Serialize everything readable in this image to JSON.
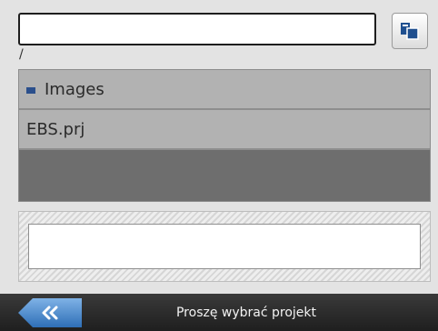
{
  "path_field": {
    "value": "",
    "placeholder": ""
  },
  "copy_button": {
    "icon": "paste-icon",
    "color": "#1f4f8f"
  },
  "current_path": "/",
  "file_list": {
    "items": [
      {
        "label": "Images",
        "type": "folder",
        "icon": "folder-icon"
      },
      {
        "label": "EBS.prj",
        "type": "file"
      }
    ]
  },
  "project_name_field": {
    "value": "",
    "placeholder": ""
  },
  "bottom_bar": {
    "back_icon": "double-chevron-left-icon",
    "back_label": "«",
    "status": "Proszę wybrać projekt"
  },
  "colors": {
    "background": "#e3e3e3",
    "list_row": "#b2b2b2",
    "list_empty": "#6e6e6e",
    "bar": "#2a2a2a",
    "accent": "#2e6fb7"
  }
}
